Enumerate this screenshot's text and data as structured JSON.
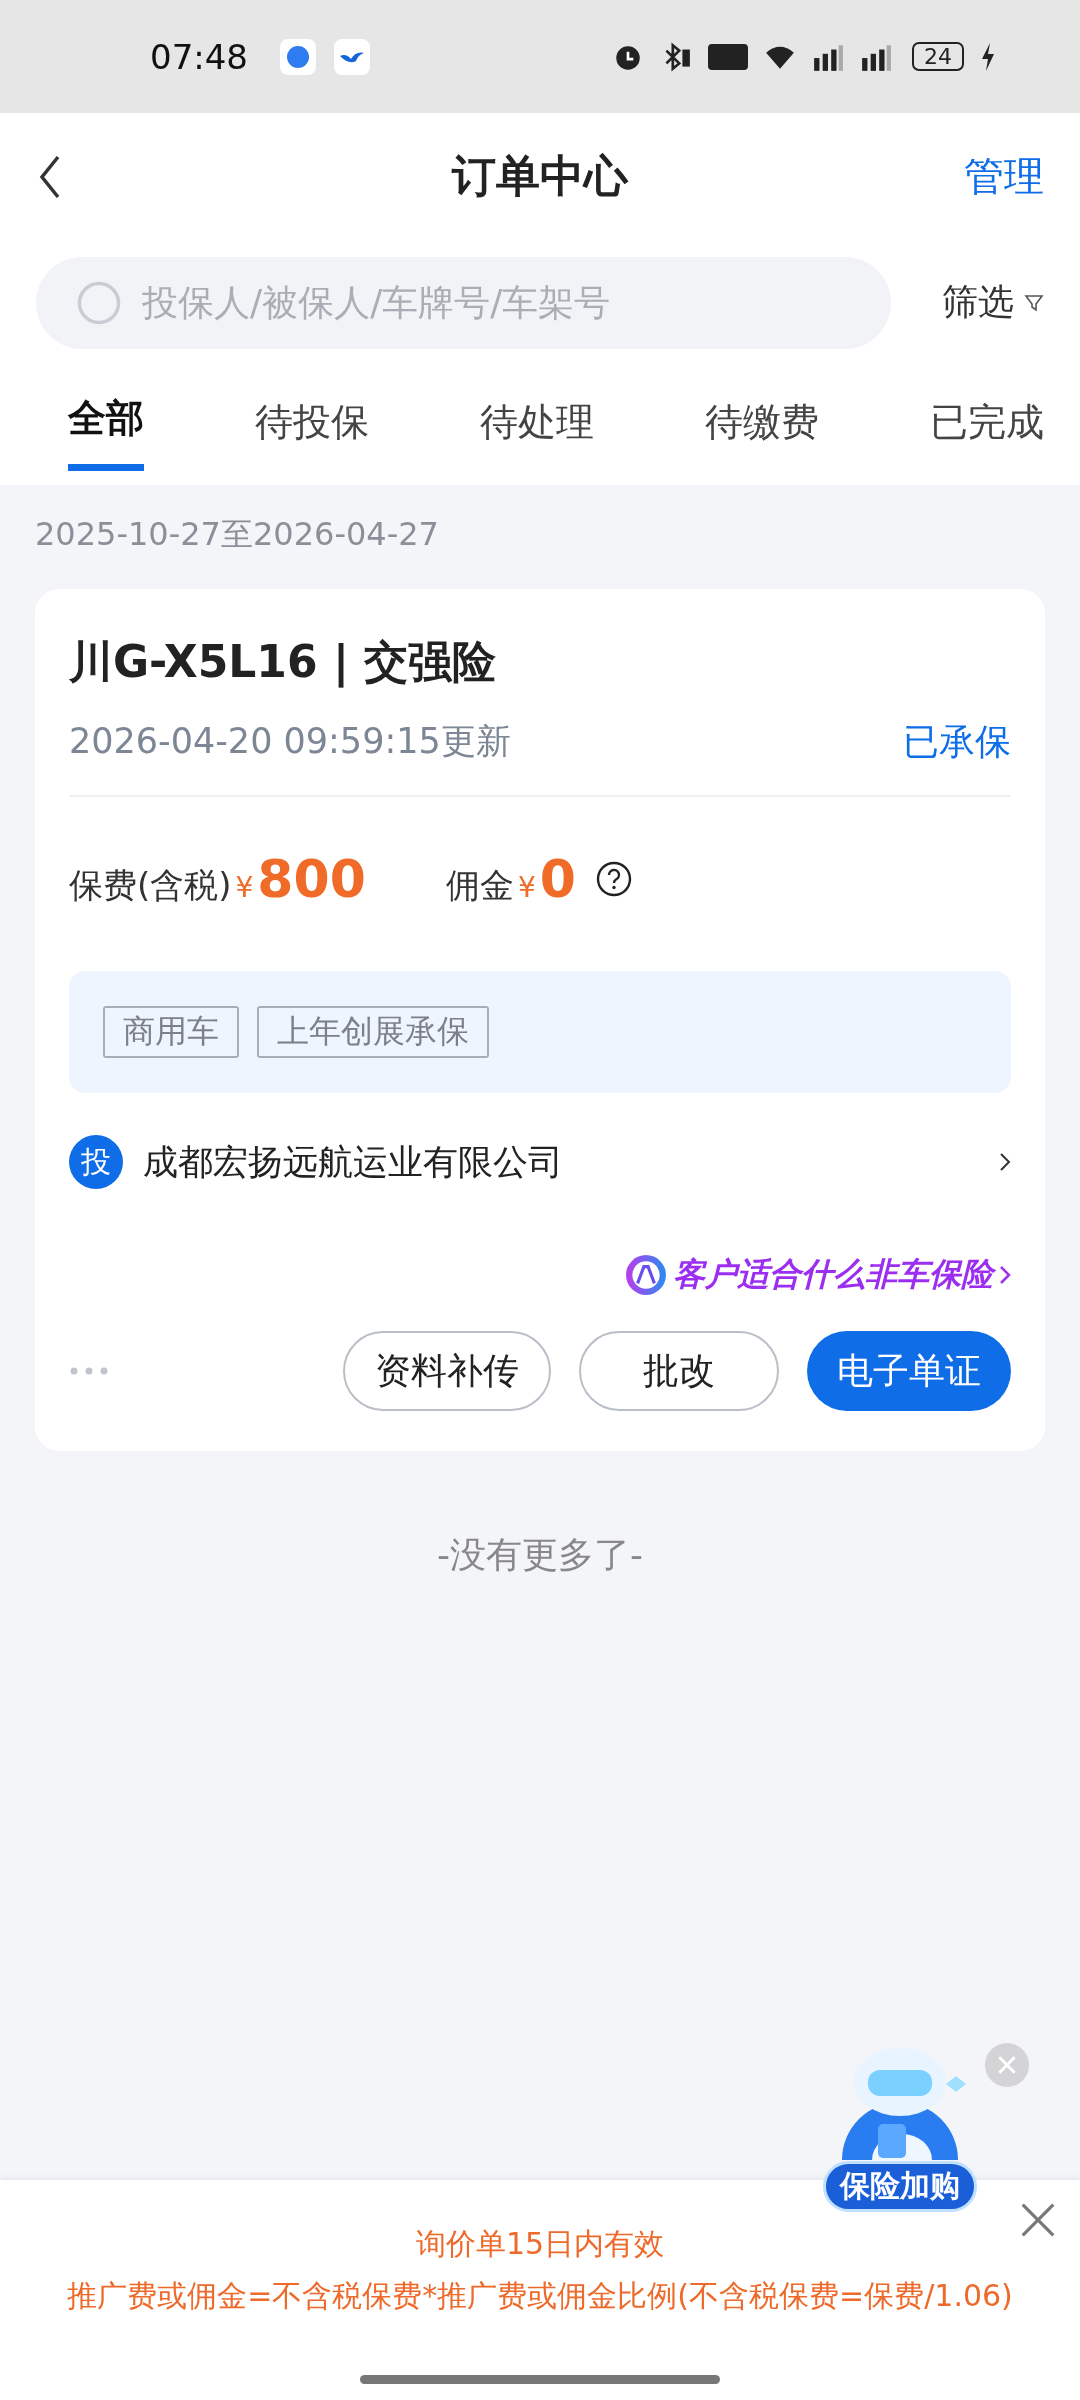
{
  "status_bar": {
    "time": "07:48",
    "battery": "24"
  },
  "header": {
    "title": "订单中心",
    "action": "管理"
  },
  "search": {
    "placeholder": "投保人/被保人/车牌号/车架号",
    "filter": "筛选"
  },
  "tabs": [
    {
      "label": "全部",
      "selected": true
    },
    {
      "label": "待投保",
      "selected": false
    },
    {
      "label": "待处理",
      "selected": false
    },
    {
      "label": "待缴费",
      "selected": false
    },
    {
      "label": "已完成",
      "selected": false
    }
  ],
  "date_range": "2025-10-27至2026-04-27",
  "orders": [
    {
      "title": "川G-X5L16 | 交强险",
      "updated": "2026-04-20 09:59:15更新",
      "status": "已承保",
      "premium_label": "保费(含税)",
      "premium_currency": "¥",
      "premium": "800",
      "commission_label": "佣金",
      "commission_currency": "¥",
      "commission": "0",
      "tags": [
        "商用车",
        "上年创展承保"
      ],
      "holder_badge": "投",
      "holder": "成都宏扬远航运业有限公司",
      "ai_promo": "客户适合什么非车保险",
      "buttons": [
        {
          "label": "资料补传",
          "kind": "outline"
        },
        {
          "label": "批改",
          "kind": "outline"
        },
        {
          "label": "电子单证",
          "kind": "primary"
        }
      ]
    }
  ],
  "end_note": "-没有更多了-",
  "floating_badge": {
    "label": "保险加购"
  },
  "notice": {
    "lines": [
      "询价单15日内有效",
      "推广费或佣金=不含税保费*推广费或佣金比例(不含税保费=保费/1.06)"
    ]
  }
}
